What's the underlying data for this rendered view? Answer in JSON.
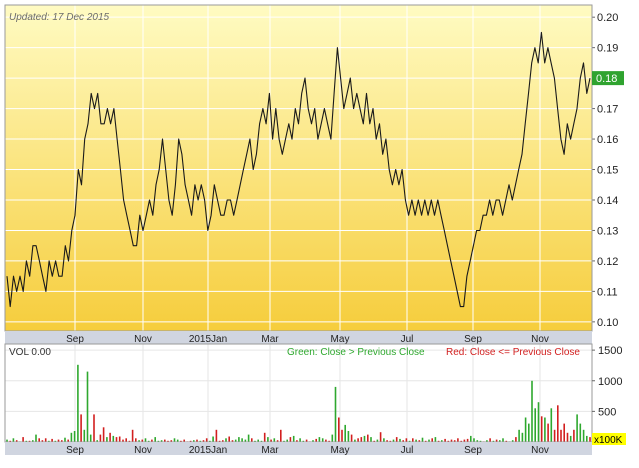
{
  "updated_label": "Updated: 17 Dec 2015",
  "current_price_label": "0.18",
  "volume_label": "VOL  0.00",
  "legend_green": "Green: Close > Previous Close",
  "legend_red": "Red: Close <= Previous Close",
  "volume_unit_label": "x100K",
  "colors": {
    "price_line": "#1a1a1a",
    "up_volume": "#2ea82e",
    "down_volume": "#d21f1f",
    "current_badge": "#2fa32f",
    "gradient_top": "#fffbc2",
    "gradient_bottom": "#f6cd3c",
    "unit_badge": "#ffff00"
  },
  "chart_data": [
    {
      "type": "line",
      "name": "price",
      "x_ticks": [
        "Sep",
        "Nov",
        "2015Jan",
        "Mar",
        "May",
        "Jul",
        "Sep",
        "Nov"
      ],
      "y_ticks": [
        "0.10",
        "0.11",
        "0.12",
        "0.13",
        "0.14",
        "0.15",
        "0.16",
        "0.17",
        "0.18",
        "0.19",
        "0.20"
      ],
      "ylim": [
        0.097,
        0.204
      ],
      "grid": true,
      "y_axis_position": "right",
      "last_value": 0.18,
      "values": [
        0.115,
        0.105,
        0.115,
        0.11,
        0.115,
        0.11,
        0.12,
        0.115,
        0.125,
        0.125,
        0.12,
        0.115,
        0.11,
        0.12,
        0.115,
        0.12,
        0.115,
        0.115,
        0.125,
        0.12,
        0.13,
        0.135,
        0.15,
        0.145,
        0.16,
        0.165,
        0.175,
        0.17,
        0.175,
        0.165,
        0.165,
        0.17,
        0.165,
        0.17,
        0.16,
        0.15,
        0.14,
        0.135,
        0.13,
        0.125,
        0.125,
        0.135,
        0.13,
        0.135,
        0.14,
        0.135,
        0.145,
        0.15,
        0.16,
        0.15,
        0.14,
        0.135,
        0.145,
        0.16,
        0.155,
        0.145,
        0.14,
        0.135,
        0.145,
        0.14,
        0.145,
        0.14,
        0.13,
        0.135,
        0.145,
        0.14,
        0.135,
        0.135,
        0.14,
        0.14,
        0.135,
        0.14,
        0.145,
        0.15,
        0.155,
        0.16,
        0.15,
        0.155,
        0.165,
        0.17,
        0.165,
        0.175,
        0.16,
        0.17,
        0.16,
        0.155,
        0.16,
        0.165,
        0.16,
        0.17,
        0.165,
        0.175,
        0.18,
        0.17,
        0.165,
        0.17,
        0.16,
        0.165,
        0.17,
        0.165,
        0.16,
        0.175,
        0.19,
        0.18,
        0.17,
        0.175,
        0.18,
        0.17,
        0.175,
        0.17,
        0.165,
        0.175,
        0.165,
        0.17,
        0.16,
        0.165,
        0.155,
        0.16,
        0.15,
        0.145,
        0.15,
        0.145,
        0.15,
        0.14,
        0.135,
        0.14,
        0.135,
        0.14,
        0.135,
        0.14,
        0.135,
        0.14,
        0.135,
        0.14,
        0.135,
        0.13,
        0.125,
        0.12,
        0.115,
        0.11,
        0.105,
        0.105,
        0.115,
        0.12,
        0.125,
        0.13,
        0.13,
        0.135,
        0.135,
        0.14,
        0.135,
        0.14,
        0.14,
        0.135,
        0.14,
        0.145,
        0.14,
        0.145,
        0.15,
        0.155,
        0.165,
        0.175,
        0.185,
        0.19,
        0.185,
        0.195,
        0.185,
        0.19,
        0.185,
        0.18,
        0.17,
        0.16,
        0.155,
        0.165,
        0.16,
        0.165,
        0.17,
        0.18,
        0.185,
        0.175,
        0.18
      ]
    },
    {
      "type": "bar",
      "name": "volume",
      "x_ticks": [
        "Sep",
        "Nov",
        "2015Jan",
        "Mar",
        "May",
        "Jul",
        "Sep",
        "Nov"
      ],
      "y_ticks": [
        "500",
        "1000",
        "1500"
      ],
      "ylim": [
        0,
        1600
      ],
      "unit": "x100K",
      "y_axis_position": "right",
      "values": [
        40,
        20,
        60,
        30,
        10,
        80,
        20,
        20,
        30,
        120,
        60,
        30,
        60,
        20,
        50,
        20,
        40,
        30,
        70,
        40,
        150,
        180,
        1260,
        450,
        200,
        1150,
        120,
        450,
        30,
        120,
        240,
        80,
        150,
        100,
        80,
        90,
        40,
        60,
        20,
        200,
        60,
        30,
        40,
        60,
        20,
        40,
        80,
        20,
        30,
        40,
        20,
        30,
        60,
        40,
        20,
        40,
        10,
        20,
        30,
        40,
        20,
        30,
        60,
        20,
        90,
        200,
        20,
        30,
        60,
        90,
        30,
        40,
        80,
        60,
        40,
        120,
        60,
        20,
        40,
        20,
        150,
        80,
        40,
        60,
        30,
        200,
        20,
        40,
        80,
        100,
        30,
        60,
        20,
        40,
        10,
        30,
        50,
        80,
        60,
        40,
        20,
        120,
        900,
        400,
        200,
        280,
        180,
        120,
        40,
        60,
        80,
        100,
        120,
        80,
        20,
        40,
        160,
        60,
        30,
        20,
        40,
        80,
        50,
        30,
        60,
        20,
        60,
        40,
        30,
        70,
        20,
        40,
        60,
        80,
        20,
        30,
        50,
        20,
        40,
        30,
        60,
        20,
        40,
        50,
        100,
        60,
        30,
        20,
        10,
        30,
        60,
        20,
        40,
        30,
        60,
        20,
        10,
        30,
        80,
        200,
        150,
        400,
        300,
        1000,
        550,
        650,
        420,
        400,
        300,
        550,
        200,
        600,
        200,
        300,
        150,
        100,
        200,
        450,
        300,
        200,
        100,
        80
      ],
      "up": [
        1,
        0,
        1,
        0,
        1,
        0,
        1,
        0,
        1,
        1,
        0,
        0,
        0,
        1,
        0,
        1,
        0,
        0,
        1,
        0,
        1,
        1,
        1,
        0,
        1,
        1,
        1,
        0,
        1,
        0,
        0,
        1,
        0,
        1,
        0,
        0,
        0,
        0,
        0,
        0,
        0,
        1,
        0,
        1,
        1,
        0,
        1,
        1,
        1,
        0,
        0,
        0,
        1,
        1,
        0,
        0,
        0,
        0,
        1,
        0,
        1,
        0,
        0,
        1,
        1,
        0,
        0,
        0,
        1,
        0,
        0,
        1,
        1,
        1,
        1,
        1,
        0,
        1,
        1,
        1,
        0,
        1,
        0,
        1,
        0,
        0,
        1,
        1,
        0,
        1,
        0,
        1,
        1,
        0,
        0,
        1,
        0,
        1,
        1,
        0,
        0,
        1,
        1,
        0,
        0,
        1,
        1,
        0,
        1,
        0,
        0,
        1,
        0,
        1,
        0,
        1,
        0,
        1,
        0,
        0,
        1,
        0,
        1,
        0,
        0,
        1,
        0,
        1,
        0,
        1,
        0,
        1,
        0,
        1,
        0,
        1,
        0,
        0,
        0,
        0,
        0,
        0,
        0,
        0,
        1,
        1,
        1,
        1,
        0,
        1,
        0,
        1,
        0,
        1,
        1,
        0,
        1,
        1,
        0,
        1,
        1,
        1,
        1,
        1,
        1,
        1,
        0,
        1,
        0,
        1,
        0,
        0,
        0,
        0,
        0,
        1,
        0,
        1,
        1,
        1,
        1,
        0,
        1
      ]
    }
  ]
}
